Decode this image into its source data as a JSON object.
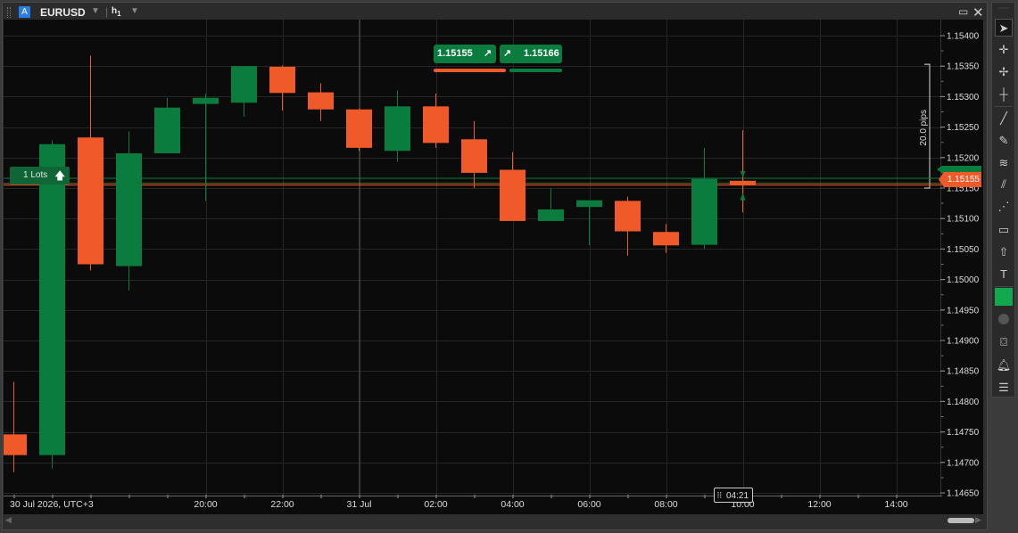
{
  "window": {
    "account_badge": "A",
    "symbol": "EURUSD",
    "timeframe_main": "h",
    "timeframe_sub": "1",
    "dropdown_glyph": "▼",
    "maximize_glyph": "▭",
    "close_glyph": "✕"
  },
  "trade_panel": {
    "sell_price": "1.15155",
    "buy_price": "1.15166",
    "sell_arrow": "↗",
    "buy_arrow": "↗",
    "sell_color": "#f05a28",
    "buy_color": "#0a7d3e"
  },
  "lots": {
    "label": "1 Lots",
    "arrow": "🡅"
  },
  "current_price": "1.15155",
  "countdown": {
    "grip": "⠿",
    "text": "04:21"
  },
  "measure": {
    "label": "20.0 pips"
  },
  "toolbar": {
    "icons": [
      "pointer-icon",
      "crosshair-icon",
      "move-icon",
      "cross-icon",
      "trendline-icon",
      "pencil-icon",
      "fibonacci-icon",
      "pitchfork-icon",
      "grid-icon",
      "rectangle-icon",
      "arrow-up-icon",
      "text-icon",
      "color-swatch-icon",
      "circle-icon",
      "camera-icon",
      "bell-icon",
      "list-add-icon"
    ]
  },
  "chart_data": {
    "type": "candlestick",
    "symbol": "EURUSD",
    "timeframe": "h1",
    "ylim": [
      1.1462,
      1.15425
    ],
    "y_ticks": [
      "1.15400",
      "1.15350",
      "1.15300",
      "1.15250",
      "1.15200",
      "1.15150",
      "1.15100",
      "1.15050",
      "1.15000",
      "1.14950",
      "1.14900",
      "1.14850",
      "1.14800",
      "1.14750",
      "1.14700",
      "1.14650"
    ],
    "x_labels": [
      {
        "label": "30 Jul 2026, UTC+3",
        "bar": -0.5
      },
      {
        "label": "20:00",
        "bar": 5
      },
      {
        "label": "22:00",
        "bar": 7
      },
      {
        "label": "31 Jul",
        "bar": 9
      },
      {
        "label": "02:00",
        "bar": 11
      },
      {
        "label": "04:00",
        "bar": 13
      },
      {
        "label": "06:00",
        "bar": 15
      },
      {
        "label": "08:00",
        "bar": 17
      },
      {
        "label": "10:00",
        "bar": 19
      },
      {
        "label": "12:00",
        "bar": 21
      },
      {
        "label": "14:00",
        "bar": 23
      }
    ],
    "candles": [
      {
        "o": 1.14746,
        "h": 1.14832,
        "l": 1.14684,
        "c": 1.14712
      },
      {
        "o": 1.14712,
        "h": 1.15228,
        "l": 1.1469,
        "c": 1.15222
      },
      {
        "o": 1.15233,
        "h": 1.15367,
        "l": 1.15015,
        "c": 1.15025
      },
      {
        "o": 1.15022,
        "h": 1.15243,
        "l": 1.14982,
        "c": 1.15207
      },
      {
        "o": 1.15207,
        "h": 1.15298,
        "l": 1.15207,
        "c": 1.15282
      },
      {
        "o": 1.15288,
        "h": 1.15305,
        "l": 1.15129,
        "c": 1.15298
      },
      {
        "o": 1.1529,
        "h": 1.1535,
        "l": 1.15267,
        "c": 1.1535
      },
      {
        "o": 1.15349,
        "h": 1.15351,
        "l": 1.15277,
        "c": 1.15306
      },
      {
        "o": 1.15307,
        "h": 1.15322,
        "l": 1.1526,
        "c": 1.15279
      },
      {
        "o": 1.15279,
        "h": 1.1528,
        "l": 1.15211,
        "c": 1.15216
      },
      {
        "o": 1.15211,
        "h": 1.1531,
        "l": 1.15193,
        "c": 1.15284
      },
      {
        "o": 1.15284,
        "h": 1.15305,
        "l": 1.15216,
        "c": 1.15224
      },
      {
        "o": 1.1523,
        "h": 1.1526,
        "l": 1.1515,
        "c": 1.15175
      },
      {
        "o": 1.1518,
        "h": 1.15209,
        "l": 1.15096,
        "c": 1.15096
      },
      {
        "o": 1.15096,
        "h": 1.1515,
        "l": 1.15096,
        "c": 1.15115
      },
      {
        "o": 1.15119,
        "h": 1.15127,
        "l": 1.15056,
        "c": 1.1513
      },
      {
        "o": 1.15129,
        "h": 1.15136,
        "l": 1.15039,
        "c": 1.15079
      },
      {
        "o": 1.15078,
        "h": 1.15091,
        "l": 1.15044,
        "c": 1.15056
      },
      {
        "o": 1.15057,
        "h": 1.15216,
        "l": 1.1505,
        "c": 1.15165
      },
      {
        "o": 1.15162,
        "h": 1.15245,
        "l": 1.1511,
        "c": 1.15155
      }
    ],
    "bid_line": 1.15155,
    "ask_line": 1.15166,
    "measure_range": [
      1.1515,
      1.15353
    ]
  }
}
